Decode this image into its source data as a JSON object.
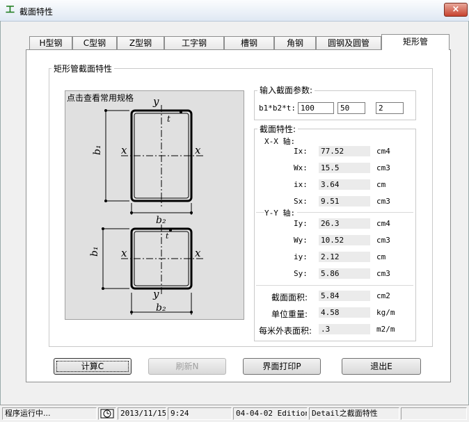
{
  "window": {
    "title": "截面特性",
    "app_icon": "工",
    "close": "×"
  },
  "tabs": [
    {
      "label": "H型钢"
    },
    {
      "label": "C型钢"
    },
    {
      "label": "Z型钢"
    },
    {
      "label": "工字钢"
    },
    {
      "label": "槽钢"
    },
    {
      "label": "角钢"
    },
    {
      "label": "圆钢及圆管"
    },
    {
      "label": "矩形管",
      "active": true
    }
  ],
  "main_group": {
    "title": "矩形管截面特性"
  },
  "figure": {
    "caption": "点击查看常用规格",
    "labels": {
      "y": "y",
      "x": "x",
      "t": "t",
      "b1": "b₁",
      "b2": "b₂"
    }
  },
  "input_group": {
    "title": "输入截面参数:",
    "param_label": "b1*b2*t:",
    "b1": "100",
    "b2": "50",
    "t": "2"
  },
  "props_group": {
    "title": "截面特性:",
    "xx_axis": "X-X 轴:",
    "yy_axis": "Y-Y 轴:",
    "Ix": {
      "label": "Ix:",
      "value": "77.52",
      "unit": "cm4"
    },
    "Wx": {
      "label": "Wx:",
      "value": "15.5",
      "unit": "cm3"
    },
    "ix": {
      "label": "ix:",
      "value": "3.64",
      "unit": "cm"
    },
    "Sx": {
      "label": "Sx:",
      "value": "9.51",
      "unit": "cm3"
    },
    "Iy": {
      "label": "Iy:",
      "value": "26.3",
      "unit": "cm4"
    },
    "Wy": {
      "label": "Wy:",
      "value": "10.52",
      "unit": "cm3"
    },
    "iy": {
      "label": "iy:",
      "value": "2.12",
      "unit": "cm"
    },
    "Sy": {
      "label": "Sy:",
      "value": "5.86",
      "unit": "cm3"
    },
    "area": {
      "label": "截面面积:",
      "value": "5.84",
      "unit": "cm2"
    },
    "weight": {
      "label": "单位重量:",
      "value": "4.58",
      "unit": "kg/m"
    },
    "surface": {
      "label": "每米外表面积:",
      "value": ".3",
      "unit": "m2/m"
    }
  },
  "buttons": {
    "calc": "计算C",
    "refresh": "刷新N",
    "print": "界面打印P",
    "exit": "退出E"
  },
  "status": {
    "running": "程序运行中...",
    "date": "2013/11/15",
    "time": "9:24",
    "edition": "04-04-02 Edition",
    "detail": "Detail之截面特性"
  }
}
